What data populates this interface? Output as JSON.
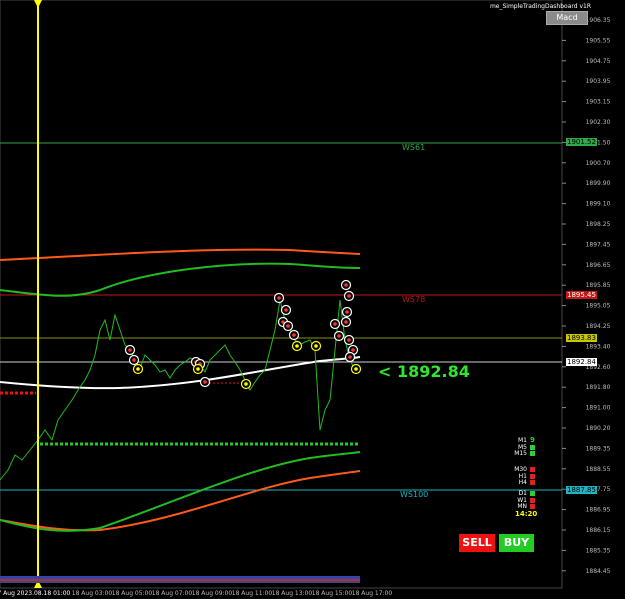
{
  "indicator_name": "me_SimpleTradingDashboard v1R",
  "macd_button": "Macd",
  "price_readout": "< 1892.84",
  "levels": [
    {
      "name": "WS61",
      "price": "1901.52",
      "color": "#2fa84a"
    },
    {
      "name": "WS78",
      "price": "1895.45",
      "color": "#c01818"
    },
    {
      "name": "WS100",
      "price": "1887.85",
      "color": "#20b4c0"
    }
  ],
  "price_tags": [
    {
      "text": "1893.83",
      "color": "#c8c800"
    },
    {
      "text": "1892.84",
      "color": "#ffffff"
    }
  ],
  "price_axis": [
    "1906.35",
    "1905.55",
    "1904.75",
    "1903.95",
    "1903.15",
    "1902.30",
    "1901.50",
    "1900.70",
    "1899.90",
    "1899.10",
    "1898.25",
    "1897.45",
    "1896.65",
    "1895.85",
    "1895.05",
    "1894.25",
    "1893.40",
    "1892.60",
    "1891.80",
    "1891.00",
    "1890.20",
    "1889.35",
    "1888.55",
    "1887.75",
    "1886.95",
    "1886.15",
    "1885.35",
    "1884.45"
  ],
  "time_axis": [
    "17 Aug 2023.08.18 01:00",
    "18 Aug 03:00",
    "18 Aug 05:00",
    "18 Aug 07:00",
    "18 Aug 09:00",
    "18 Aug 11:00",
    "18 Aug 13:00",
    "18 Aug 15:00",
    "18 Aug 17:00"
  ],
  "timeframes_group1": [
    {
      "label": "M1",
      "value": "9",
      "color": "#33cc33"
    },
    {
      "label": "M5",
      "value": "",
      "color": "#33cc33"
    },
    {
      "label": "M15",
      "value": "",
      "color": "#33cc33"
    }
  ],
  "timeframes_group2": [
    {
      "label": "M30",
      "value": "",
      "color": "#dd2222"
    },
    {
      "label": "H1",
      "value": "",
      "color": "#dd2222"
    },
    {
      "label": "H4",
      "value": "",
      "color": "#dd2222"
    }
  ],
  "timeframes_group3": [
    {
      "label": "D1",
      "value": "",
      "color": "#33cc33"
    },
    {
      "label": "W1",
      "value": "",
      "color": "#dd2222"
    },
    {
      "label": "MN",
      "value": "",
      "color": "#dd2222"
    }
  ],
  "clock": "14:20",
  "sell_label": "SELL",
  "buy_label": "BUY",
  "colors": {
    "bull": "#22cc22",
    "bear": "#ee1111",
    "cursor": "#ffff00"
  }
}
